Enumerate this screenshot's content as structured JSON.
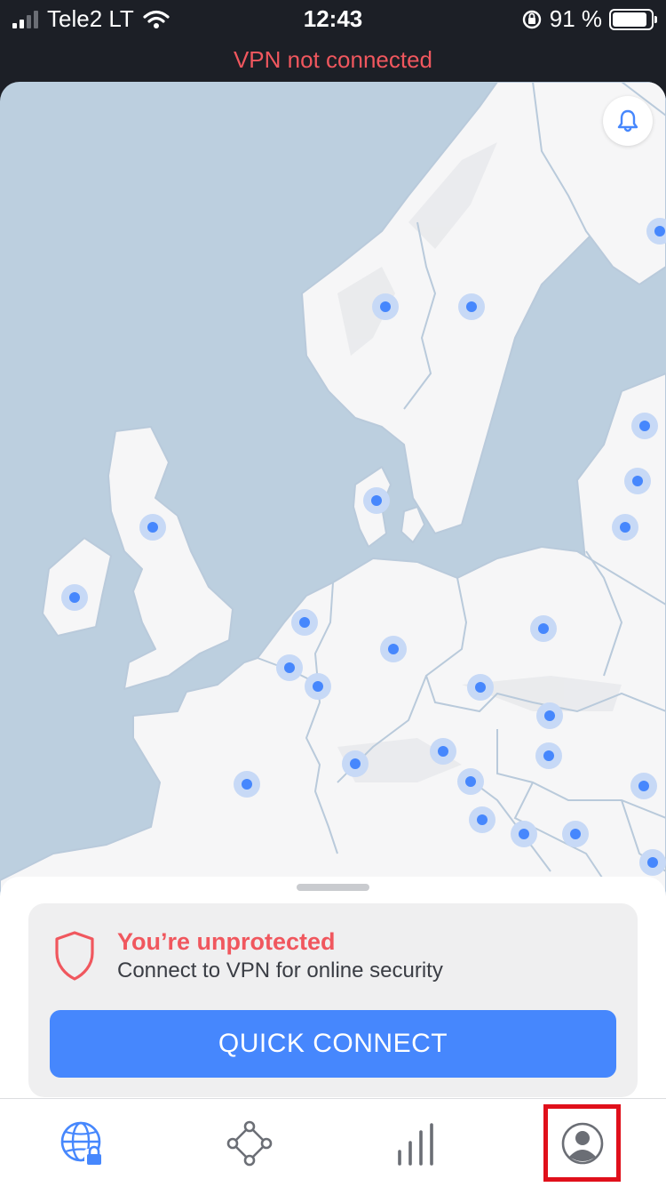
{
  "status_bar": {
    "carrier": "Tele2 LT",
    "time": "12:43",
    "battery_percent": "91 %",
    "battery_level": 0.91
  },
  "vpn_status": "VPN not connected",
  "map": {
    "icons": [
      "bell-icon",
      "server-location-dot"
    ]
  },
  "card": {
    "title": "You’re unprotected",
    "subtitle": "Connect to VPN for online security",
    "button_label": "QUICK CONNECT"
  },
  "tab_bar": {
    "tabs": [
      "globe-lock-icon",
      "meshnet-icon",
      "stats-icon",
      "profile-icon"
    ],
    "active": "globe-lock-icon"
  },
  "colors": {
    "accent": "#4687fd",
    "warning": "#f0575e",
    "water": "#bccfdf",
    "land": "#f6f6f7",
    "highlight": "#e0101b"
  }
}
